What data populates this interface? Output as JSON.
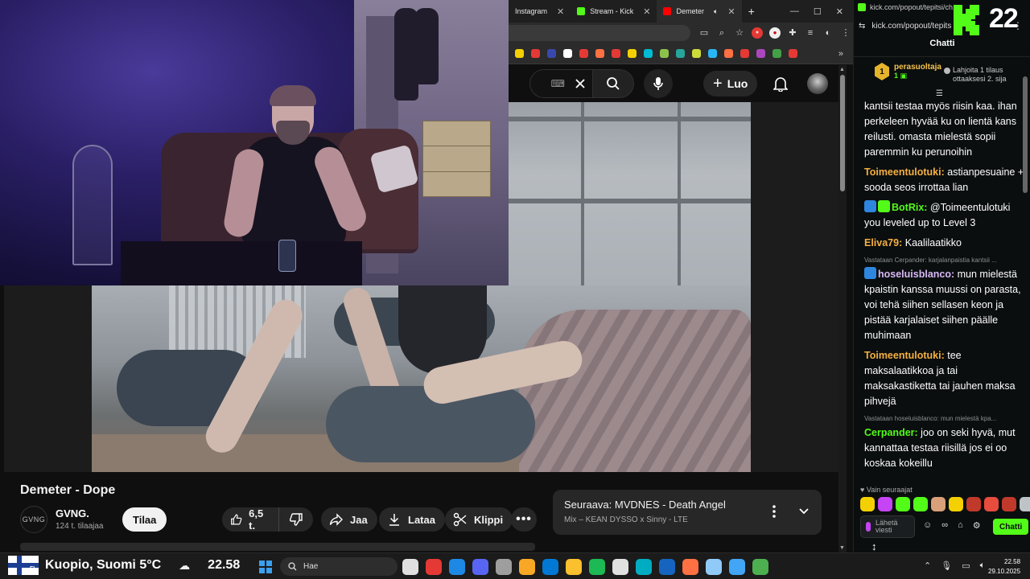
{
  "browser": {
    "tabs": [
      {
        "label": "Instagram",
        "color": "#e1306c",
        "active": false
      },
      {
        "label": "Stream - Kick",
        "color": "#53fc18",
        "active": false
      },
      {
        "label": "Demeter",
        "color": "#ff0000",
        "active": true
      }
    ],
    "new_tab": "+",
    "bookmark_colors": [
      "#f5d000",
      "#e53935",
      "#3949ab",
      "#ffffff",
      "#e53935",
      "#ff7043",
      "#e53935",
      "#f5d000",
      "#00bcd4",
      "#8bc34a",
      "#26a69a",
      "#cddc39",
      "#29b6f6",
      "#ff7043",
      "#e53935",
      "#ab47bc",
      "#43a047",
      "#e53935"
    ],
    "bookmarks_more": "»"
  },
  "youtube": {
    "create_label": "Luo",
    "video": {
      "title": "Demeter - Dope",
      "channel": "GVNG.",
      "channel_avatar_text": "GVNG",
      "subscribers": "124 t. tilaajaa",
      "subscribe_label": "Tilaa",
      "likes": "6,5 t.",
      "share_label": "Jaa",
      "download_label": "Lataa",
      "clip_label": "Klippi"
    },
    "up_next": {
      "prefix": "Seuraava:",
      "title": "MVDNES - Death Angel",
      "subtitle": "Mix – KEAN DYSSO x Sinny - LTE"
    }
  },
  "chat": {
    "url_title": "kick.com/popout/tepitsi/ch...",
    "url": "kick.com/popout/tepits",
    "viewer_count": "22",
    "title": "Chatti",
    "top_gifter": {
      "rank": "1",
      "name": "perasuoltaja",
      "count": "1"
    },
    "gift_cta": "Lahjoita 1 tilaus ottaaksesi 2. sija",
    "messages": [
      {
        "user": "",
        "text": "kantsii testaa myös riisin kaa. ihan perkeleen hyvää ku on lientä kans reilusti. omasta mielestä sopii paremmin ku perunoihin",
        "color": "#ffffff",
        "reply": "",
        "badges": []
      },
      {
        "user": "Toimeentulotuki",
        "text": "astianpesuaine + sooda seos irrottaa lian",
        "color": "#f5b041",
        "reply": "",
        "badges": []
      },
      {
        "user": "BotRix",
        "text": "@Toimeentulotuki you leveled up to Level 3",
        "color": "#53fc18",
        "reply": "",
        "badges": [
          "#2e86de",
          "#53fc18"
        ]
      },
      {
        "user": "Eliva79",
        "text": "Kaalilaatikko",
        "color": "#f5b041",
        "reply": "",
        "badges": []
      },
      {
        "user": "hoseluisblanco",
        "text": "mun mielestä kpaistin kanssa muussi on parasta, voi tehä siihen sellasen keon ja pistää karjalaiset siihen päälle muhimaan",
        "color": "#d7b8f5",
        "reply": "Vastataan Cerpander: karjalanpaistia kantsii ...",
        "badges": [
          "#2e86de"
        ]
      },
      {
        "user": "Toimeentulotuki",
        "text": "tee maksalaatikkoa ja tai maksakastiketta tai jauhen maksa pihvejä",
        "color": "#f5b041",
        "reply": "",
        "badges": []
      },
      {
        "user": "Cerpander",
        "text": "joo on seki hyvä, mut kannattaa testaa riisillä jos ei oo koskaa kokeillu",
        "color": "#53fc18",
        "reply": "Vastataan hoseluisblanco: mun mielestä kpa...",
        "badges": []
      }
    ],
    "followers_only": "Vain seuraajat",
    "emote_colors": [
      "#f5d000",
      "#c545f5",
      "#53fc18",
      "#53fc18",
      "#d9a07a",
      "#f5d000",
      "#c0392b",
      "#e74c3c",
      "#c0392b",
      "#bdc3c7",
      "#e74c3c"
    ],
    "input_placeholder": "Lähetä viesti",
    "send_label": "Chatti"
  },
  "taskbar": {
    "flag_code": "FI",
    "location_temp": "Kuopio, Suomi 5°C",
    "weather_time": "22.58",
    "search_label": "Hae",
    "app_colors": [
      "#e0e0e0",
      "#e53935",
      "#1e88e5",
      "#5865f2",
      "#9e9e9e",
      "#f9a825",
      "#0078d4",
      "#fbc02d",
      "#1db954",
      "#e0e0e0",
      "#00acc1",
      "#1565c0",
      "#ff7043",
      "#90caf9",
      "#42a5f5",
      "#4caf50"
    ],
    "time": "22.58",
    "date": "29.10.2025"
  }
}
